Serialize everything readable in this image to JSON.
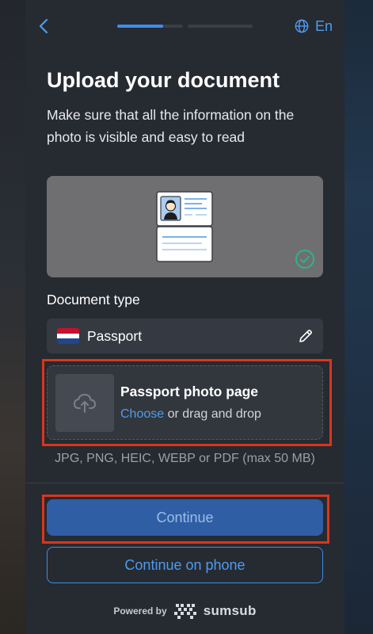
{
  "header": {
    "language_label": "En",
    "progress_steps": [
      {
        "fill": 0.7
      },
      {
        "fill": 0
      }
    ]
  },
  "title": "Upload your document",
  "subtitle": "Make sure that all the information on the photo is visible and easy to read",
  "document_type": {
    "label": "Document type",
    "value": "Passport",
    "flag_colors": [
      "#c8102e",
      "#ffffff",
      "#21468b"
    ]
  },
  "upload": {
    "title": "Passport photo page",
    "choose_link": "Choose",
    "drag_text": " or drag and drop",
    "formats": "JPG, PNG, HEIC, WEBP or PDF (max 50 MB)"
  },
  "buttons": {
    "continue": "Continue",
    "continue_on_phone": "Continue on phone"
  },
  "footer": {
    "powered_by": "Powered by",
    "brand": "sumsub"
  },
  "colors": {
    "accent": "#3d8ee8",
    "highlight": "#d9361c",
    "success": "#2fb38a"
  }
}
